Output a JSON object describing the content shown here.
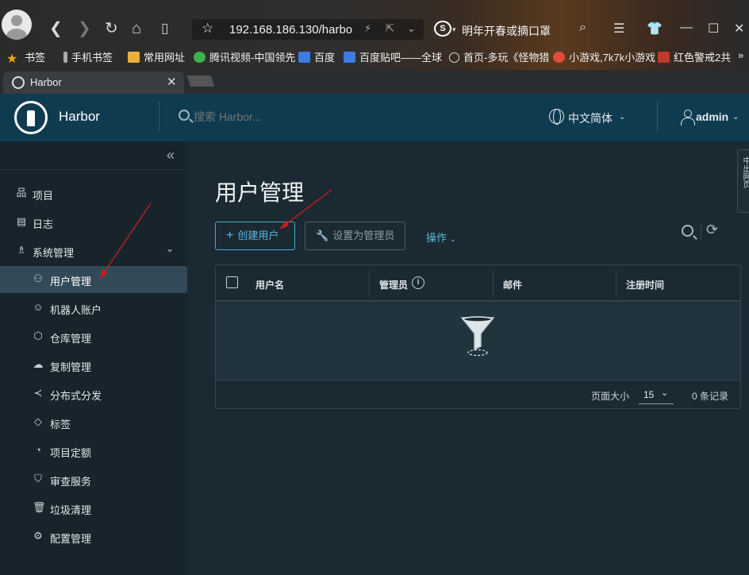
{
  "browser": {
    "address": "192.168.186.130/harbo",
    "search_suggestion": "明年开春或摘口罩",
    "bookmarks": [
      {
        "label": "书签",
        "icon": "star-icon"
      },
      {
        "label": "手机书签",
        "icon": "phone-icon"
      },
      {
        "label": "常用网址",
        "icon": "folder-icon"
      },
      {
        "label": "腾讯视频-中国领先",
        "icon": "tencent-video-icon"
      },
      {
        "label": "百度",
        "icon": "baidu-icon"
      },
      {
        "label": "百度贴吧——全球",
        "icon": "baidu-tieba-icon"
      },
      {
        "label": "首页-多玩《怪物猎",
        "icon": "globe-icon"
      },
      {
        "label": "小游戏,7k7k小游戏",
        "icon": "game-icon"
      },
      {
        "label": "红色警戒2共",
        "icon": "home-icon"
      }
    ],
    "tab": {
      "title": "Harbor"
    }
  },
  "header": {
    "brand": "Harbor",
    "search_placeholder": "搜索 Harbor...",
    "language": "中文简体",
    "user": "admin"
  },
  "sidebar": {
    "items": [
      {
        "label": "项目",
        "icon": "project-icon"
      },
      {
        "label": "日志",
        "icon": "log-icon"
      },
      {
        "label": "系统管理",
        "icon": "admin-icon"
      }
    ],
    "sub_items": [
      {
        "label": "用户管理",
        "icon": "users-icon",
        "active": true
      },
      {
        "label": "机器人账户",
        "icon": "robot-icon"
      },
      {
        "label": "仓库管理",
        "icon": "box-icon"
      },
      {
        "label": "复制管理",
        "icon": "cloud-icon"
      },
      {
        "label": "分布式分发",
        "icon": "share-icon"
      },
      {
        "label": "标签",
        "icon": "tag-icon"
      },
      {
        "label": "项目定额",
        "icon": "quota-icon"
      },
      {
        "label": "审查服务",
        "icon": "shield-icon"
      },
      {
        "label": "垃圾清理",
        "icon": "trash-icon"
      },
      {
        "label": "配置管理",
        "icon": "gear-icon"
      }
    ]
  },
  "main": {
    "title": "用户管理",
    "create_button": "创建用户",
    "set_admin_button": "设置为管理员",
    "actions_label": "操作",
    "columns": [
      "用户名",
      "管理员",
      "邮件",
      "注册时间"
    ],
    "footer": {
      "page_size_label": "页面大小",
      "page_size": "15",
      "count": "0 条记录"
    }
  },
  "side_tab": {
    "label": "中出网页"
  },
  "colors": {
    "header_bg": "#0f3b50",
    "sidebar_bg": "#17242b",
    "main_bg": "#1b2a32",
    "accent": "#4ba6d1",
    "annotation_arrow": "#d21a1a"
  }
}
